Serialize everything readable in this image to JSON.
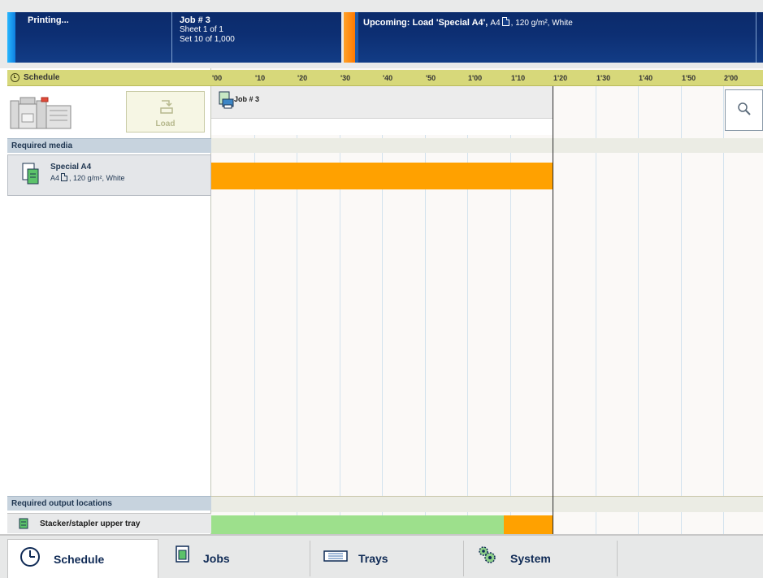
{
  "status": {
    "state": "Printing...",
    "job_title": "Job # 3",
    "job_sheet": "Sheet 1 of 1",
    "job_set": "Set 10 of 1,000",
    "upcoming_prefix": "Upcoming: Load 'Special A4',",
    "upcoming_size": "A4",
    "upcoming_detail": ", 120 g/m², White"
  },
  "colors": {
    "status_bg": "#0d2f73",
    "left_accent": "#1f9cf0",
    "upcoming_accent": "#ff8c00",
    "schedule_header": "#d7d87a",
    "section_bar": "#c7d3de",
    "media_bar": "#ffa100",
    "output_done": "#9de08c",
    "output_pending": "#ffa100"
  },
  "schedule": {
    "header": "Schedule",
    "clock_icon": "clock-icon",
    "load_button": "Load",
    "required_media_label": "Required media",
    "media_name": "Special A4",
    "media_size": "A4",
    "media_detail": ", 120 g/m², White",
    "output_label": "Required output locations",
    "output_location": "Stacker/stapler upper tray",
    "job_label": "Job # 3",
    "ticks": [
      "'00",
      "'10",
      "'20",
      "'30",
      "'40",
      "'50",
      "1'00",
      "1'10",
      "1'20",
      "1'30",
      "1'40",
      "1'50",
      "2'00"
    ]
  },
  "timeline": {
    "now_min": 80,
    "job_end_min": 80,
    "media_end_min": 80,
    "output_done_end_min": 68.5,
    "output_pending_end_min": 80
  },
  "nav": {
    "schedule": "Schedule",
    "jobs": "Jobs",
    "trays": "Trays",
    "system": "System"
  }
}
